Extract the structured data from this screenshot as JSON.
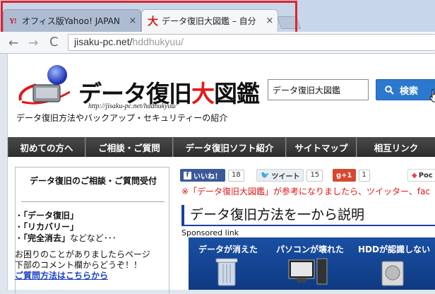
{
  "browser": {
    "tabs": [
      {
        "favicon": "Y!",
        "title": "オフィス版Yahoo! JAPAN",
        "close": "×"
      },
      {
        "favicon": "大",
        "title": "データ復旧大図鑑 – 自分",
        "close": "×"
      }
    ],
    "nav": {
      "back": "←",
      "forward": "→",
      "reload": "C"
    },
    "url": {
      "host": "jisaku-pc.net/",
      "path": "hddhukyuu/"
    }
  },
  "header": {
    "title_pre": "データ復旧",
    "title_red": "大",
    "title_post": "図鑑",
    "url": "http://jisaku-pc.net/hddhukyuu/",
    "tagline": "データ復旧方法やバックアップ・セキュリティーの紹介"
  },
  "search": {
    "value": "データ復旧大図鑑",
    "button_label": "検索",
    "button_icon": "search-icon"
  },
  "navbar": {
    "items": [
      "初めての方へ",
      "ご相談・ご質問",
      "データ復旧ソフト紹介",
      "サイトマップ",
      "相互リンク"
    ]
  },
  "sidebar": {
    "title": "データ復旧のご相談・ご質問受付",
    "bullets": [
      {
        "prefix": "・",
        "text": "「データ復旧」",
        "suffix": ""
      },
      {
        "prefix": "・",
        "text": "「リカバリー」",
        "suffix": ""
      },
      {
        "prefix": "・",
        "text": "「完全消去」",
        "suffix": "などなど･･･"
      }
    ],
    "body_line1": "お困りのことがありましたらページ",
    "body_line2": "下部のコメント欄からどうぞ！！",
    "link": "ご質問方法はこちらから"
  },
  "social": {
    "facebook": {
      "label": "いいね！",
      "count": "18"
    },
    "twitter": {
      "label": "ツイート",
      "count": "15"
    },
    "gplus": {
      "label": "g+1",
      "count": "1"
    },
    "pocket": {
      "label": "Poc"
    }
  },
  "main": {
    "notice": "※「データ復旧大図鑑」が参考になりましたら、ツイッター、fac",
    "article_title": "データ復旧方法を一から説明",
    "sponsored": "Sponsored link",
    "banner_labels": [
      "データが消えた",
      "パソコンが壊れた",
      "HDDが認識しない"
    ]
  },
  "colors": {
    "accent": "#2d78cf",
    "highlight": "#e0242c",
    "navbar": "#3c3c3c",
    "link": "#1a3fc7",
    "notice": "#e01414"
  }
}
